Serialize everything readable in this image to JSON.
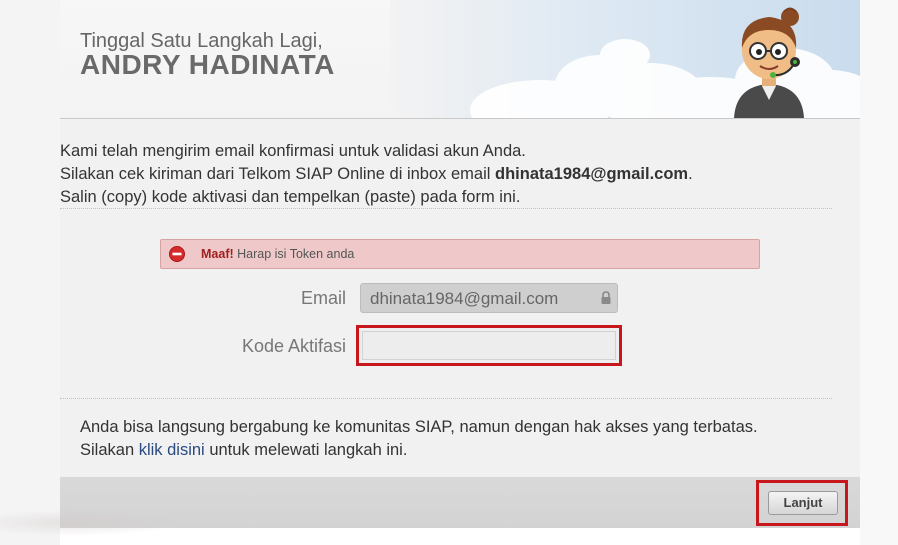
{
  "header": {
    "greeting": "Tinggal Satu Langkah Lagi,",
    "username": "ANDRY HADINATA",
    "mascot_icon": "operator-mascot-icon"
  },
  "info": {
    "line1": "Kami telah mengirim email konfirmasi untuk validasi akun Anda.",
    "line2_prefix": "Silakan cek kiriman dari Telkom SIAP Online di inbox email ",
    "line2_email": "dhinata1984@gmail.com",
    "line2_suffix": ".",
    "line3": "Salin (copy) kode aktivasi dan tempelkan (paste) pada form ini."
  },
  "alert": {
    "title": "Maaf!",
    "message": "Harap isi Token anda",
    "icon": "error-icon",
    "color": "#efc9c9"
  },
  "form": {
    "email_label": "Email",
    "email_value": "dhinata1984@gmail.com",
    "code_label": "Kode Aktifasi",
    "code_value": ""
  },
  "community": {
    "line1": "Anda bisa langsung bergabung ke komunitas SIAP, namun dengan hak akses yang terbatas.",
    "line2_prefix": "Silakan ",
    "line2_link": "klik disini",
    "line2_suffix": " untuk melewati langkah ini."
  },
  "footer": {
    "next_label": "Lanjut"
  },
  "colors": {
    "highlight": "#c8161d",
    "link": "#2a4a80"
  }
}
